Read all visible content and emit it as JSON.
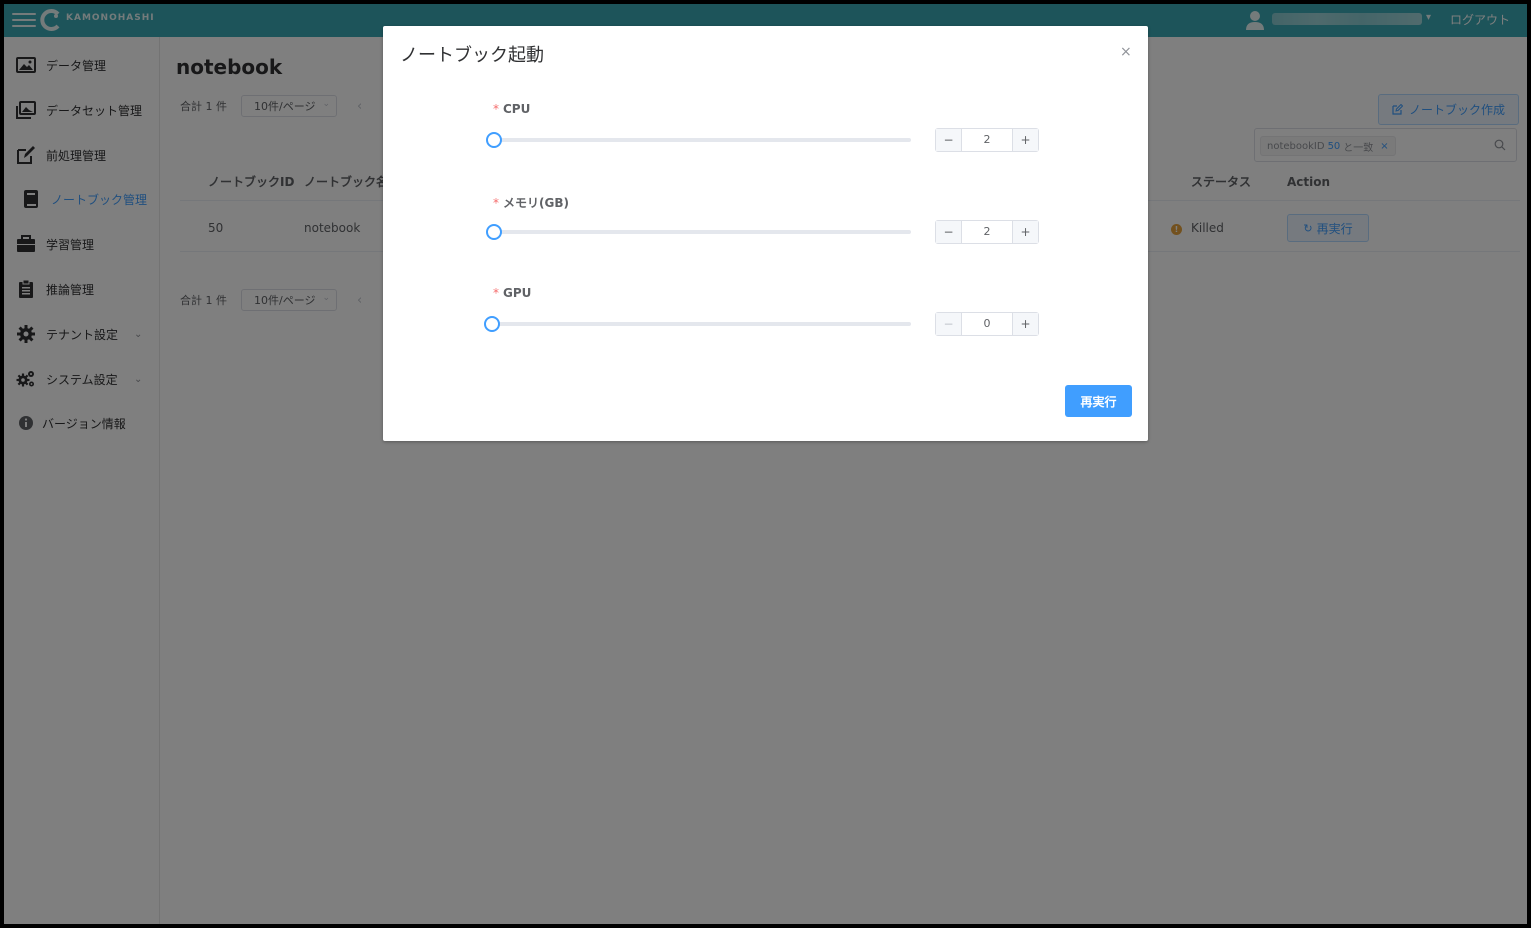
{
  "header": {
    "brand": "KAMONOHASHI",
    "logout": "ログアウト",
    "color": "#3aa9b4"
  },
  "sidebar": {
    "items": [
      {
        "label": "データ管理",
        "icon": "image-icon"
      },
      {
        "label": "データセット管理",
        "icon": "images-icon"
      },
      {
        "label": "前処理管理",
        "icon": "edit-icon"
      },
      {
        "label": "ノートブック管理",
        "icon": "book-icon",
        "active": true
      },
      {
        "label": "学習管理",
        "icon": "briefcase-icon"
      },
      {
        "label": "推論管理",
        "icon": "clipboard-icon"
      },
      {
        "label": "テナント設定",
        "icon": "gear-icon",
        "expandable": true
      },
      {
        "label": "システム設定",
        "icon": "gears-icon",
        "expandable": true
      },
      {
        "label": "バージョン情報",
        "icon": "info-icon"
      }
    ]
  },
  "main": {
    "title": "notebook",
    "pager": {
      "total": "合計 1 件",
      "page_size": "10件/ページ"
    },
    "create_button": "ノートブック作成",
    "filter": {
      "tag_key": "notebookID",
      "tag_value": "50",
      "tag_suffix": "と一致"
    },
    "table": {
      "headers": [
        "ノートブックID",
        "ノートブック名",
        "ステータス",
        "Action"
      ],
      "rows": [
        {
          "id": "50",
          "name": "notebook",
          "status": "Killed",
          "action": "再実行"
        }
      ]
    }
  },
  "dialog": {
    "title": "ノートブック起動",
    "close": "×",
    "fields": [
      {
        "label": "CPU",
        "value": "2",
        "required": "*"
      },
      {
        "label": "メモリ(GB)",
        "value": "2",
        "required": "*"
      },
      {
        "label": "GPU",
        "value": "0",
        "required": "*"
      }
    ],
    "stepper": {
      "minus": "−",
      "plus": "+"
    },
    "submit": "再実行"
  }
}
